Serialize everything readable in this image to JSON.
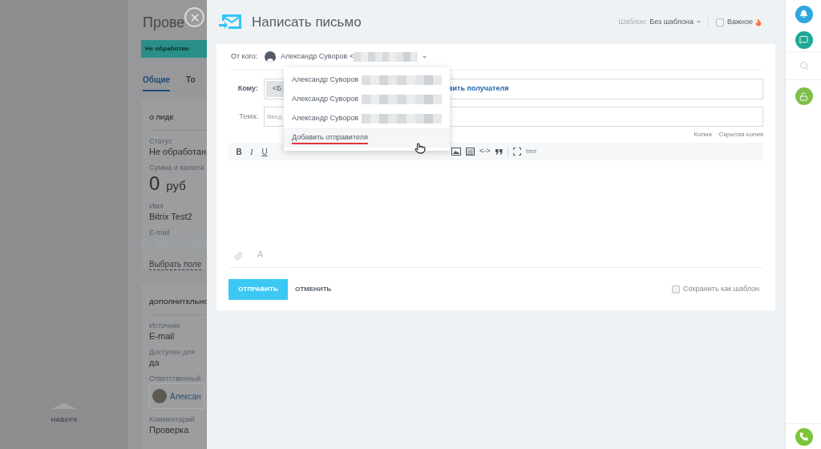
{
  "background_page": {
    "title": "Прове",
    "status_badge": "Не обработан",
    "tabs": [
      {
        "label": "Общие",
        "selected": true
      },
      {
        "label": "То",
        "selected": false
      }
    ],
    "card": {
      "heading": "О ЛИДЕ",
      "fields": [
        {
          "kind": "text",
          "label": "Статус",
          "value": "Не обработан"
        },
        {
          "kind": "amount",
          "label": "Сумма и валюта",
          "value": "0",
          "unit": "руб"
        },
        {
          "kind": "text",
          "label": "Имя",
          "value": "Bitrix Test2"
        },
        {
          "kind": "redacted",
          "label": "E-mail"
        }
      ],
      "links": [
        "Выбрать поле"
      ]
    },
    "card_2": {
      "heading": "ДОПОЛНИТЕЛЬНО",
      "fields": [
        {
          "kind": "text",
          "label": "Источник",
          "value": "E-mail"
        },
        {
          "kind": "text",
          "label": "Доступен для",
          "value": "да"
        },
        {
          "kind": "person",
          "label": "Ответственный",
          "value": "Алексан"
        },
        {
          "kind": "text",
          "label": "Комментарий",
          "value": "Проверка"
        }
      ]
    },
    "scroll_top": "НАВЕРХ"
  },
  "composer": {
    "title": "Написать письмо",
    "template_label": "Шаблон:",
    "template_value": "Без шаблона",
    "important": {
      "label": "Важное",
      "checked": false
    },
    "from_label": "От кого:",
    "from_value": "Александр Суворов <",
    "sender_menu": [
      {
        "kind": "sender",
        "label": "Александр Суворов",
        "highlighted": false
      },
      {
        "kind": "sender",
        "label": "Александр Суворов",
        "highlighted": false
      },
      {
        "kind": "sender",
        "label": "Александр Суворов",
        "highlighted": false
      },
      {
        "kind": "action",
        "label": "Добавить отправителя",
        "highlighted": true
      }
    ],
    "to_label": "Кому:",
    "to_chip": "<Б",
    "to_link": "вить получателя",
    "subject_label": "Тема:",
    "subject_placeholder": "Введ",
    "cc_links": [
      "Копия",
      "Скрытая копия"
    ],
    "toolbar": [
      {
        "kind": "bold",
        "label": "B"
      },
      {
        "kind": "italic",
        "label": "I"
      },
      {
        "kind": "underline",
        "label": "U"
      },
      {
        "kind": "gap"
      },
      {
        "kind": "image"
      },
      {
        "kind": "table"
      },
      {
        "kind": "code",
        "label": "<->"
      },
      {
        "kind": "quote"
      },
      {
        "kind": "separator"
      },
      {
        "kind": "fullscreen"
      },
      {
        "kind": "html",
        "label": "html"
      }
    ],
    "font_button": "A",
    "send": "ОТПРАВИТЬ",
    "cancel": "ОТМЕНИТЬ",
    "save_template": {
      "label": "Сохранить как шаблон",
      "checked": false
    }
  }
}
